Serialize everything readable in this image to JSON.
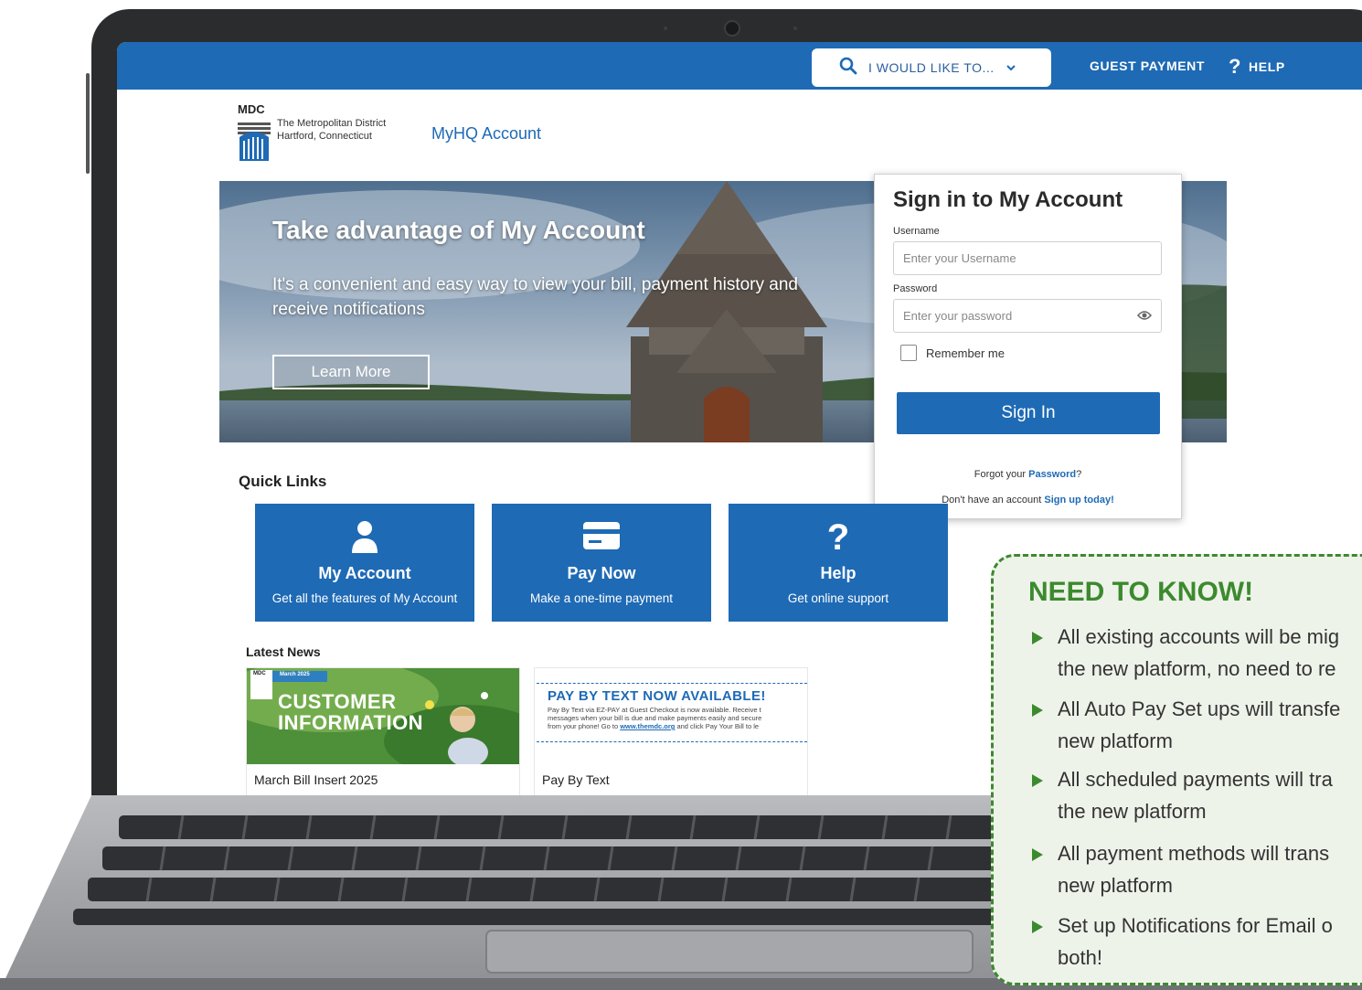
{
  "topbar": {
    "search_label": "I WOULD LIKE TO...",
    "guest_payment": "GUEST PAYMENT",
    "help": "HELP",
    "accent": "#1e6ab5"
  },
  "logo": {
    "abbr": "MDC",
    "name_line1": "The Metropolitan District",
    "name_line2": "Hartford, Connecticut"
  },
  "app_link": "MyHQ Account",
  "hero": {
    "title": "Take advantage of My Account",
    "subtitle": "It's a convenient and easy way to view your bill, payment history and receive notifications",
    "button": "Learn More"
  },
  "signin": {
    "title": "Sign in to My Account",
    "username_label": "Username",
    "username_placeholder": "Enter your Username",
    "password_label": "Password",
    "password_placeholder": "Enter your password",
    "remember": "Remember me",
    "button": "Sign In",
    "forgot_prefix": "Forgot your ",
    "forgot_link": "Password",
    "forgot_suffix": "?",
    "signup_prefix": "Don't have an account ",
    "signup_link": "Sign up today!"
  },
  "quick_links": {
    "title": "Quick Links",
    "items": [
      {
        "title": "My Account",
        "subtitle": "Get all the features of My Account",
        "icon": "user-icon"
      },
      {
        "title": "Pay Now",
        "subtitle": "Make a one-time payment",
        "icon": "credit-card-icon"
      },
      {
        "title": "Help",
        "subtitle": "Get online support",
        "icon": "question-icon"
      }
    ]
  },
  "latest_news": {
    "title": "Latest News",
    "items": [
      {
        "caption": "March Bill Insert 2025",
        "badge": "March 2025",
        "logo": "MDC",
        "line1": "CUSTOMER",
        "line2": "INFORMATION"
      },
      {
        "caption": "Pay By Text",
        "headline": "PAY BY TEXT NOW AVAILABLE!",
        "body1": "Pay By Text via EZ-PAY at Guest Checkout is now available. Receive t",
        "body2": "messages when your bill is due and make payments easily and secure",
        "body3_prefix": "from your phone! Go to ",
        "body3_link": "www.themdc.org",
        "body3_suffix": " and click Pay Your Bill to le"
      }
    ]
  },
  "need_to_know": {
    "title": "NEED TO KNOW!",
    "accent": "#3c8a2e",
    "items": [
      {
        "line1": "All existing accounts will be mig",
        "line2": "the new platform, no need to re"
      },
      {
        "line1": "All Auto Pay Set ups will transfe",
        "line2": "new platform"
      },
      {
        "line1": "All scheduled payments will tra",
        "line2": "the new platform"
      },
      {
        "line1": "All payment methods will trans",
        "line2": "new platform"
      },
      {
        "line1": "Set up Notifications for Email o",
        "line2": "both!"
      }
    ]
  }
}
